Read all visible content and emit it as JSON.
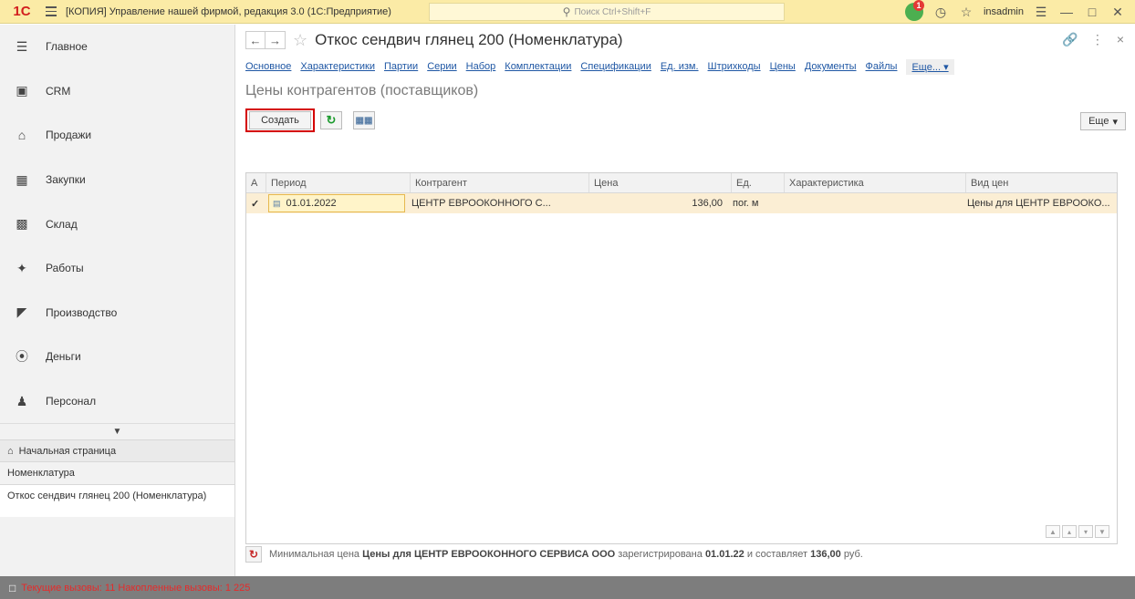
{
  "titlebar": {
    "app_title": "[КОПИЯ] Управление нашей фирмой, редакция 3.0  (1С:Предприятие)",
    "search_placeholder": "Поиск Ctrl+Shift+F",
    "notifications": "1",
    "username": "insadmin"
  },
  "sidebar": {
    "items": [
      {
        "label": "Главное",
        "icon": "menu-lines-icon"
      },
      {
        "label": "CRM",
        "icon": "crm-icon"
      },
      {
        "label": "Продажи",
        "icon": "shop-icon"
      },
      {
        "label": "Закупки",
        "icon": "purchase-icon"
      },
      {
        "label": "Склад",
        "icon": "warehouse-icon"
      },
      {
        "label": "Работы",
        "icon": "tools-icon"
      },
      {
        "label": "Производство",
        "icon": "factory-icon"
      },
      {
        "label": "Деньги",
        "icon": "money-icon"
      },
      {
        "label": "Персонал",
        "icon": "people-icon"
      }
    ],
    "history": [
      "Начальная страница",
      "Номенклатура",
      "Откос сендвич глянец 200 (Номенклатура)"
    ]
  },
  "form": {
    "title": "Откос сендвич глянец 200 (Номенклатура)",
    "links": [
      "Основное",
      "Характеристики",
      "Партии",
      "Серии",
      "Набор",
      "Комплектации",
      "Спецификации",
      "Ед. изм.",
      "Штрихкоды",
      "Цены",
      "Документы",
      "Файлы"
    ],
    "links_more": "Еще...",
    "subtitle": "Цены контрагентов (поставщиков)",
    "create_button": "Создать",
    "more_button": "Еще"
  },
  "table": {
    "columns": [
      "А",
      "Период",
      "Контрагент",
      "Цена",
      "Ед.",
      "Характеристика",
      "Вид цен"
    ],
    "rows": [
      {
        "period": "01.01.2022",
        "counterparty": "ЦЕНТР ЕВРООКОННОГО С...",
        "price": "136,00",
        "unit": "пог. м",
        "characteristic": "",
        "price_kind": "Цены для ЦЕНТР ЕВРООКО..."
      }
    ]
  },
  "footer": {
    "prefix": "Минимальная цена",
    "price_kind": "Цены для ЦЕНТР ЕВРООКОННОГО СЕРВИСА ООО",
    "mid": "зарегистрирована",
    "date": "01.01.22",
    "mid2": "и составляет",
    "amount": "136,00",
    "currency": "руб."
  },
  "statusbar": {
    "text": "Текущие вызовы: 11   Накопленные вызовы: 1 225"
  }
}
